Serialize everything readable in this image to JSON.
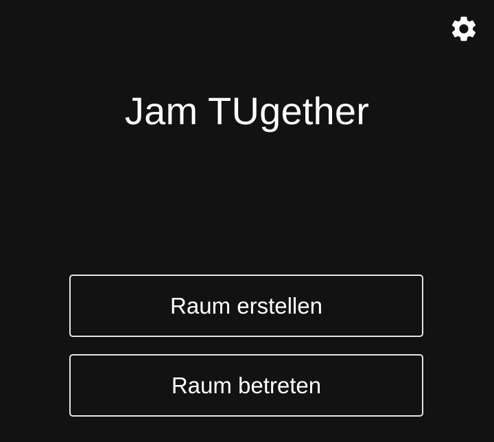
{
  "header": {
    "settings_icon": "gear-icon"
  },
  "main": {
    "title": "Jam TUgether",
    "buttons": {
      "create_room": "Raum erstellen",
      "join_room": "Raum betreten"
    }
  },
  "colors": {
    "background": "#121212",
    "text": "#ffffff",
    "button_border": "#e6e6e6"
  }
}
